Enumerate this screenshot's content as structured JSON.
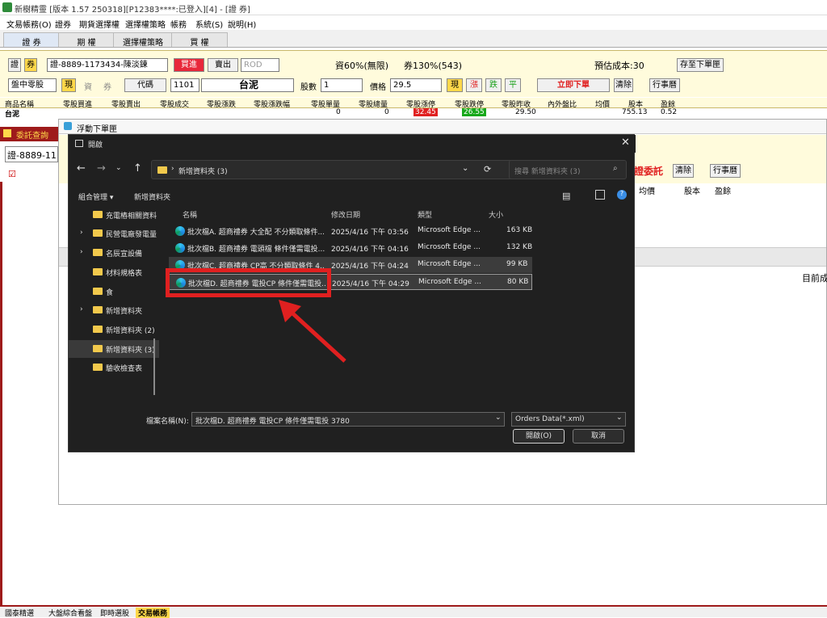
{
  "window": {
    "title": "新樹精靈 [版本 1.57 250318][P12383****:已登入][4] - [證 券]"
  },
  "menu": [
    "文易帳務(O)",
    "證券",
    "期貨選擇權",
    "選擇權策略",
    "帳務",
    "系統(S)",
    "說明(H)"
  ],
  "tabs": [
    "證 券",
    "期 權",
    "選擇權策略",
    "買 權"
  ],
  "order": {
    "mode1": "證",
    "mode2": "券",
    "account": "證-8889-1173434-陳淡鍊",
    "buy": "買進",
    "sell": "賣出",
    "rod": "ROD",
    "capital": "資60%(無限)",
    "margin": "券130%(543)",
    "estimate": "預估成本:30",
    "save": "存至下單匣",
    "type": "盤中零股",
    "cash": "現",
    "fin": "資",
    "lend": "券",
    "code_label": "代碼",
    "code": "1101",
    "name": "台泥",
    "qty_label": "股數",
    "qty": "1",
    "price_label": "價格",
    "price": "29.5",
    "cash2": "現",
    "up": "漲",
    "down": "跌",
    "flat": "平",
    "place": "立即下單",
    "clear": "清除",
    "calendar": "行事曆"
  },
  "grid": {
    "headers": [
      "商品名稱",
      "零股買進",
      "零股賣出",
      "零股成交",
      "零股漲跌",
      "零股漲跌幅",
      "零股單量",
      "零股總量",
      "零股漲停",
      "零股跌停",
      "零股昨收",
      "內外盤比",
      "均價",
      "股本",
      "盈餘"
    ],
    "row": [
      "台泥",
      "",
      "",
      "",
      "",
      "",
      "0",
      "0",
      "32.45",
      "26.55",
      "29.50",
      "",
      "",
      "755.13",
      "0.52"
    ]
  },
  "left_panel": {
    "title": "委託查詢",
    "account": "證-8889-11",
    "checkbox": "☑"
  },
  "float_window": {
    "title": "浮動下單匣",
    "place": "證委託",
    "clear": "清除",
    "calendar": "行事曆",
    "cols": [
      "均價",
      "股本",
      "盈餘"
    ],
    "right_text": "目前成"
  },
  "dialog": {
    "title": "開啟",
    "path": "新增資料夾 (3)",
    "search_placeholder": "搜尋 新增資料夾 (3)",
    "organize": "組合管理 ▾",
    "new_folder": "新增資料夾",
    "nav": [
      "充電樁相關資料",
      "民營電廠發電量",
      "名辰宣設備",
      "材料規格表",
      "食",
      "新增資料夾",
      "新增資料夾 (2)",
      "新增資料夾 (3)",
      "驗收檢查表"
    ],
    "columns": [
      "名稱",
      "修改日期",
      "類型",
      "大小"
    ],
    "files": [
      {
        "name": "批次檔A. 超商禮券 大全配 不分類取條件...",
        "date": "2025/4/16 下午 03:56",
        "type": "Microsoft Edge ...",
        "size": "163 KB"
      },
      {
        "name": "批次檔B. 超商禮券 電頭檔 條件僅需電投...",
        "date": "2025/4/16 下午 04:16",
        "type": "Microsoft Edge ...",
        "size": "132 KB"
      },
      {
        "name": "批次檔C. 超商禮券 CP高 不分類取條件 4...",
        "date": "2025/4/16 下午 04:24",
        "type": "Microsoft Edge ...",
        "size": "99 KB"
      },
      {
        "name": "批次檔D. 超商禮券 電投CP 條件僅需電投...",
        "date": "2025/4/16 下午 04:29",
        "type": "Microsoft Edge ...",
        "size": "80 KB"
      }
    ],
    "filename_label": "檔案名稱(N):",
    "filename": "批次檔D. 超商禮券 電投CP 條件僅需電投 3780",
    "filter": "Orders Data(*.xml)",
    "open": "開啟(O)",
    "cancel": "取消"
  },
  "status_tabs": [
    "國泰精選",
    "大盤綜合看盤",
    "即時選股",
    "交易帳務"
  ],
  "colors": {
    "highlight": "#e02020",
    "order_bg": "#fffbdc"
  }
}
